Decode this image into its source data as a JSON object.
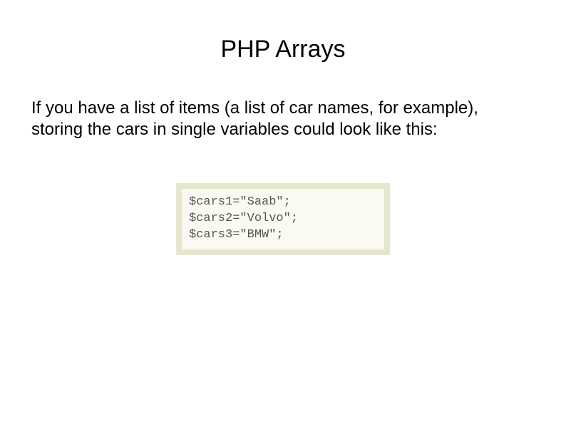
{
  "title": "PHP Arrays",
  "paragraph": "If you have a list of items (a list of car names, for example), storing the cars in single variables could look like this:",
  "code": {
    "line1": "$cars1=\"Saab\";",
    "line2": "$cars2=\"Volvo\";",
    "line3": "$cars3=\"BMW\";"
  }
}
